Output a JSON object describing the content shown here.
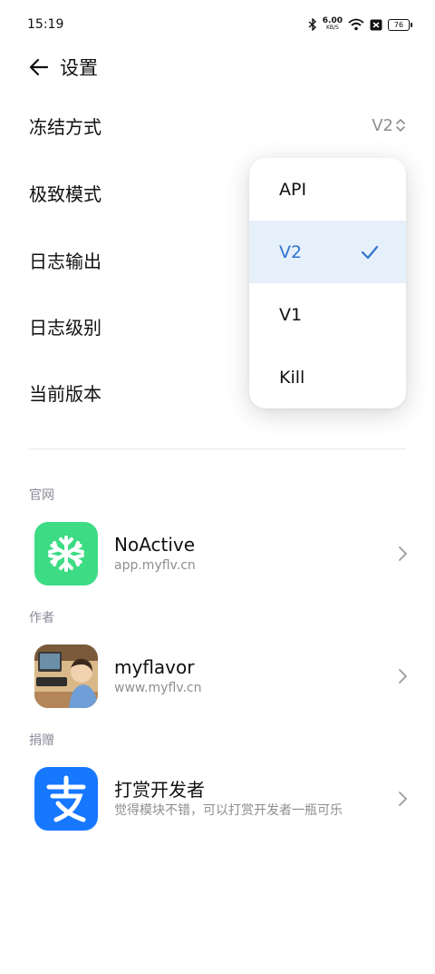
{
  "status_bar": {
    "time": "15:19",
    "net_speed_value": "6.00",
    "net_speed_unit": "KB/S",
    "battery": "76"
  },
  "header": {
    "title": "设置"
  },
  "settings": [
    {
      "label": "冻结方式",
      "value": "V2"
    },
    {
      "label": "极致模式"
    },
    {
      "label": "日志输出"
    },
    {
      "label": "日志级别"
    },
    {
      "label": "当前版本"
    }
  ],
  "dropdown": {
    "options": [
      "API",
      "V2",
      "V1",
      "Kill"
    ],
    "selected": "V2"
  },
  "sections": [
    {
      "title": "官网",
      "item": {
        "title": "NoActive",
        "subtitle": "app.myflv.cn",
        "icon": "snowflake-icon"
      }
    },
    {
      "title": "作者",
      "item": {
        "title": "myflavor",
        "subtitle": "www.myflv.cn",
        "icon": "avatar"
      }
    },
    {
      "title": "捐赠",
      "item": {
        "title": "打赏开发者",
        "subtitle": "觉得模块不错，可以打赏开发者一瓶可乐",
        "icon": "alipay-icon"
      }
    }
  ],
  "colors": {
    "accent": "#2f74d0",
    "selected_bg": "#e6f0fb",
    "noactive_green": "#3ddc84",
    "alipay_blue": "#1677ff"
  }
}
